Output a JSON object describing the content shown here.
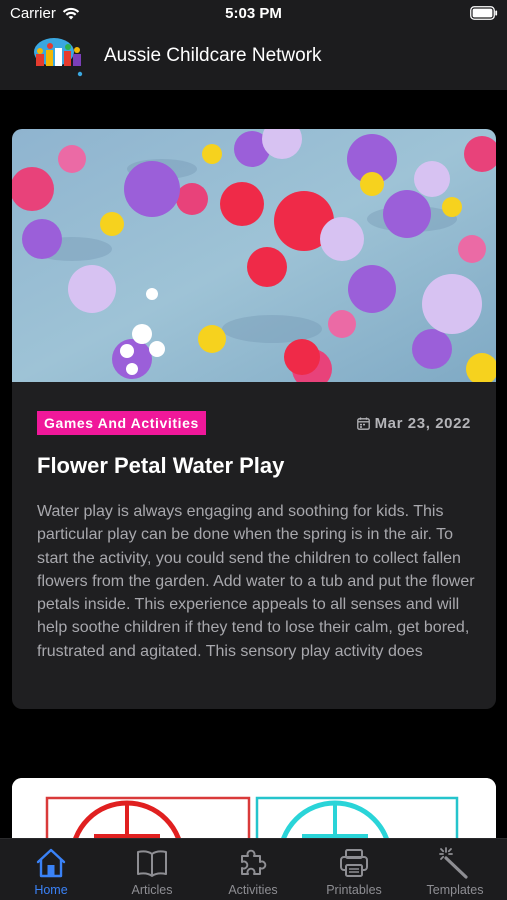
{
  "status_bar": {
    "carrier": "Carrier",
    "time": "5:03 PM"
  },
  "header": {
    "app_title": "Aussie Childcare Network"
  },
  "article": {
    "category": "Games And Activities",
    "date": "Mar 23, 2022",
    "title": "Flower Petal Water Play",
    "excerpt": "Water play is always engaging and soothing for kids. This particular play can be done when the spring is in the air. To start the activity, you could send the children to collect fallen flowers from the garden. Add water to a tub and put the flower petals inside. This experience appeals to all senses and will help soothe children if they tend to lose their calm, get bored, frustrated and agitated. This sensory play activity does"
  },
  "tabs": [
    {
      "label": "Home",
      "icon": "home-icon",
      "active": true
    },
    {
      "label": "Articles",
      "icon": "book-icon",
      "active": false
    },
    {
      "label": "Activities",
      "icon": "puzzle-icon",
      "active": false
    },
    {
      "label": "Printables",
      "icon": "printer-icon",
      "active": false
    },
    {
      "label": "Templates",
      "icon": "magic-wand-icon",
      "active": false
    }
  ],
  "colors": {
    "accent": "#3a82f7",
    "badge": "#f0189a",
    "background": "#000000",
    "card": "#1f1f21",
    "bar": "#1c1c1e",
    "inactive": "#8e8e93"
  }
}
